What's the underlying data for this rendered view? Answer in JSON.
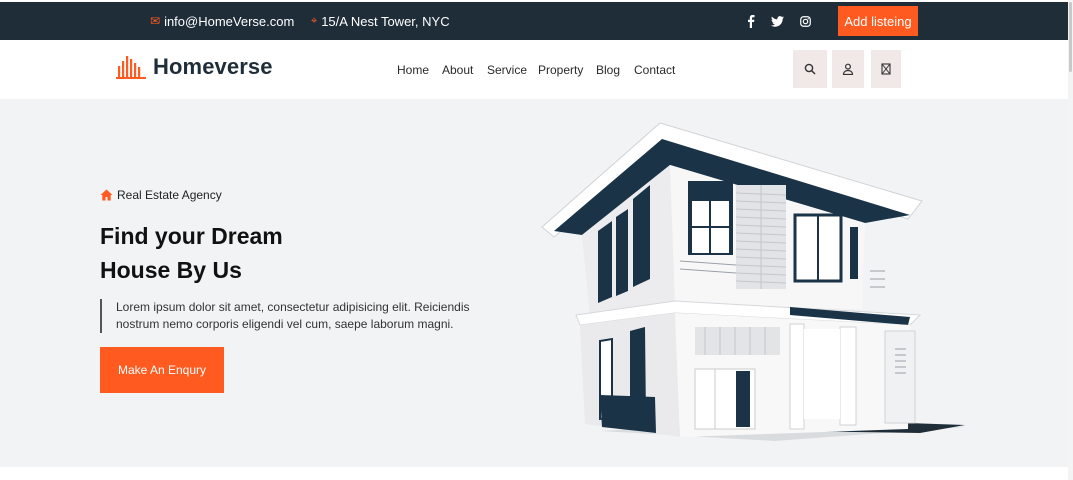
{
  "topbar": {
    "email": "info@HomeVerse.com",
    "address": "15/A Nest Tower, NYC",
    "socials": [
      {
        "icon": "facebook-icon",
        "glyph": "f"
      },
      {
        "icon": "twitter-icon",
        "glyph": "t"
      },
      {
        "icon": "instagram-icon",
        "glyph": "◎"
      }
    ],
    "add_listing_label": "Add listeing",
    "accent": "#ff5a1f",
    "background": "#1f2d39"
  },
  "header": {
    "brand": "Homeverse",
    "nav": [
      "Home",
      "About",
      "Service",
      "Property",
      "Blog",
      "Contact"
    ],
    "icons": [
      "search-icon",
      "user-icon",
      "cart-icon"
    ]
  },
  "hero": {
    "tagline": "Real Estate Agency",
    "title_line1": "Find your Dream",
    "title_line2": "House By Us",
    "text_line1": "Lorem ipsum dolor sit amet, consectetur adipisicing elit. Reiciendis",
    "text_line2": "nostrum nemo corporis eligendi vel cum, saepe laborum magni.",
    "cta_label": "Make An Enqury",
    "background": "#f2f3f4"
  }
}
